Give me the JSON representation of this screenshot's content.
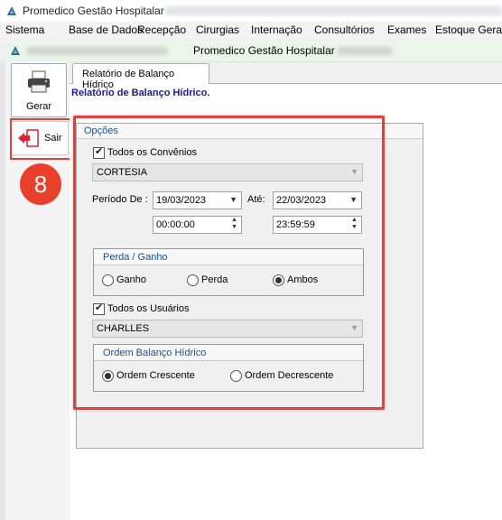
{
  "window": {
    "title": "Promedico Gestão Hospitalar"
  },
  "menu": [
    "Sistema",
    "Base de Dados",
    "Recepção",
    "Cirurgias",
    "Internação",
    "Consultórios",
    "Exames",
    "Estoque Geral"
  ],
  "inner_window": {
    "title": "Promedico Gestão Hospitalar"
  },
  "toolbar": {
    "generate_label": "Gerar",
    "exit_label": "Sair"
  },
  "badge": {
    "number": "8"
  },
  "tab": {
    "label": "Relatório de Balanço Hídrico"
  },
  "report": {
    "title": "Relatório de Balanço Hídrico."
  },
  "options": {
    "title": "Opções",
    "all_agreements": {
      "label": "Todos os Convênios",
      "checked": true
    },
    "agreement_value": "CORTESIA",
    "period": {
      "from_label": "Período De :",
      "from_date": "19/03/2023",
      "to_label": "Até:",
      "to_date": "22/03/2023",
      "from_time": "00:00:00",
      "to_time": "23:59:59"
    },
    "loss_gain": {
      "title": "Perda / Ganho",
      "options": [
        "Ganho",
        "Perda",
        "Ambos"
      ],
      "selected": "Ambos"
    },
    "all_users": {
      "label": "Todos os Usuários",
      "checked": true
    },
    "user_value": "CHARLLES",
    "order": {
      "title": "Ordem Balanço Hídrico",
      "options": [
        "Ordem Crescente",
        "Ordem Decrescente"
      ],
      "selected": "Ordem Crescente"
    }
  },
  "colors": {
    "highlight": "#e0413c",
    "badge": "#e8402b",
    "report_title": "#1a1a8c"
  }
}
